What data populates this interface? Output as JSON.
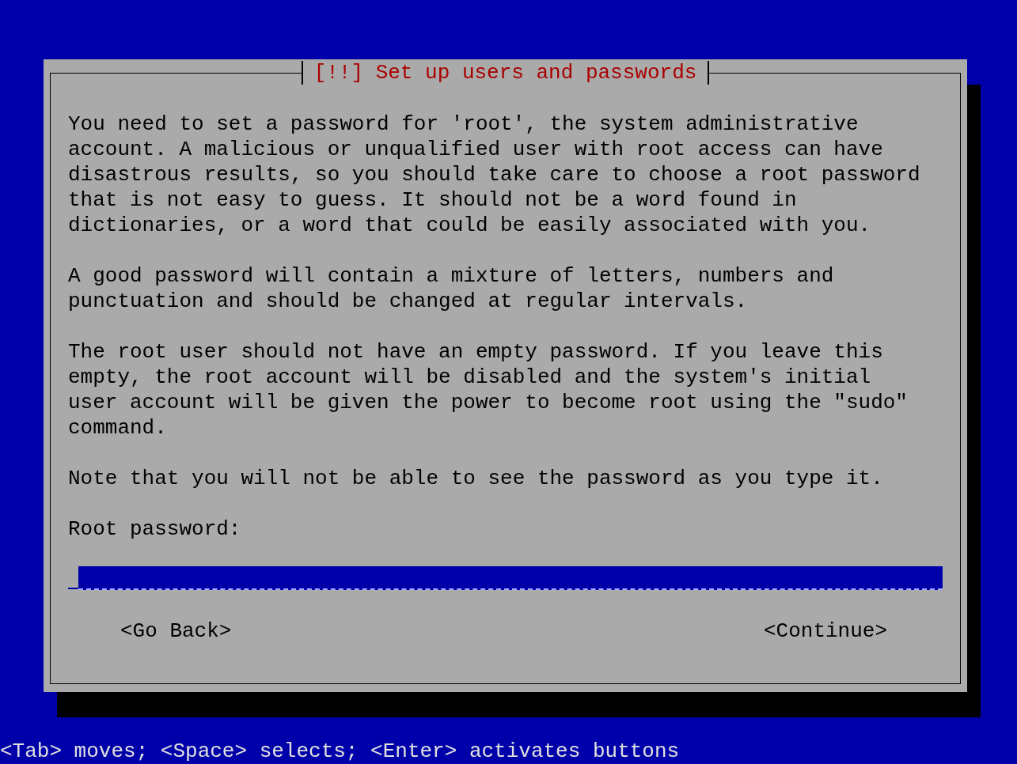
{
  "dialog": {
    "title": "[!!] Set up users and passwords",
    "paragraphs": [
      "You need to set a password for 'root', the system administrative account. A malicious or unqualified user with root access can have disastrous results, so you should take care to choose a root password that is not easy to guess. It should not be a word found in dictionaries, or a word that could be easily associated with you.",
      "A good password will contain a mixture of letters, numbers and punctuation and should be changed at regular intervals.",
      "The root user should not have an empty password. If you leave this empty, the root account will be disabled and the system's initial user account will be given the power to become root using the \"sudo\" command.",
      "Note that you will not be able to see the password as you type it."
    ],
    "field": {
      "label": "Root password:"
    },
    "buttons": [
      {
        "label": "<Go Back>"
      },
      {
        "label": "<Continue>"
      }
    ]
  },
  "help_line": "<Tab> moves; <Space> selects; <Enter> activates buttons"
}
